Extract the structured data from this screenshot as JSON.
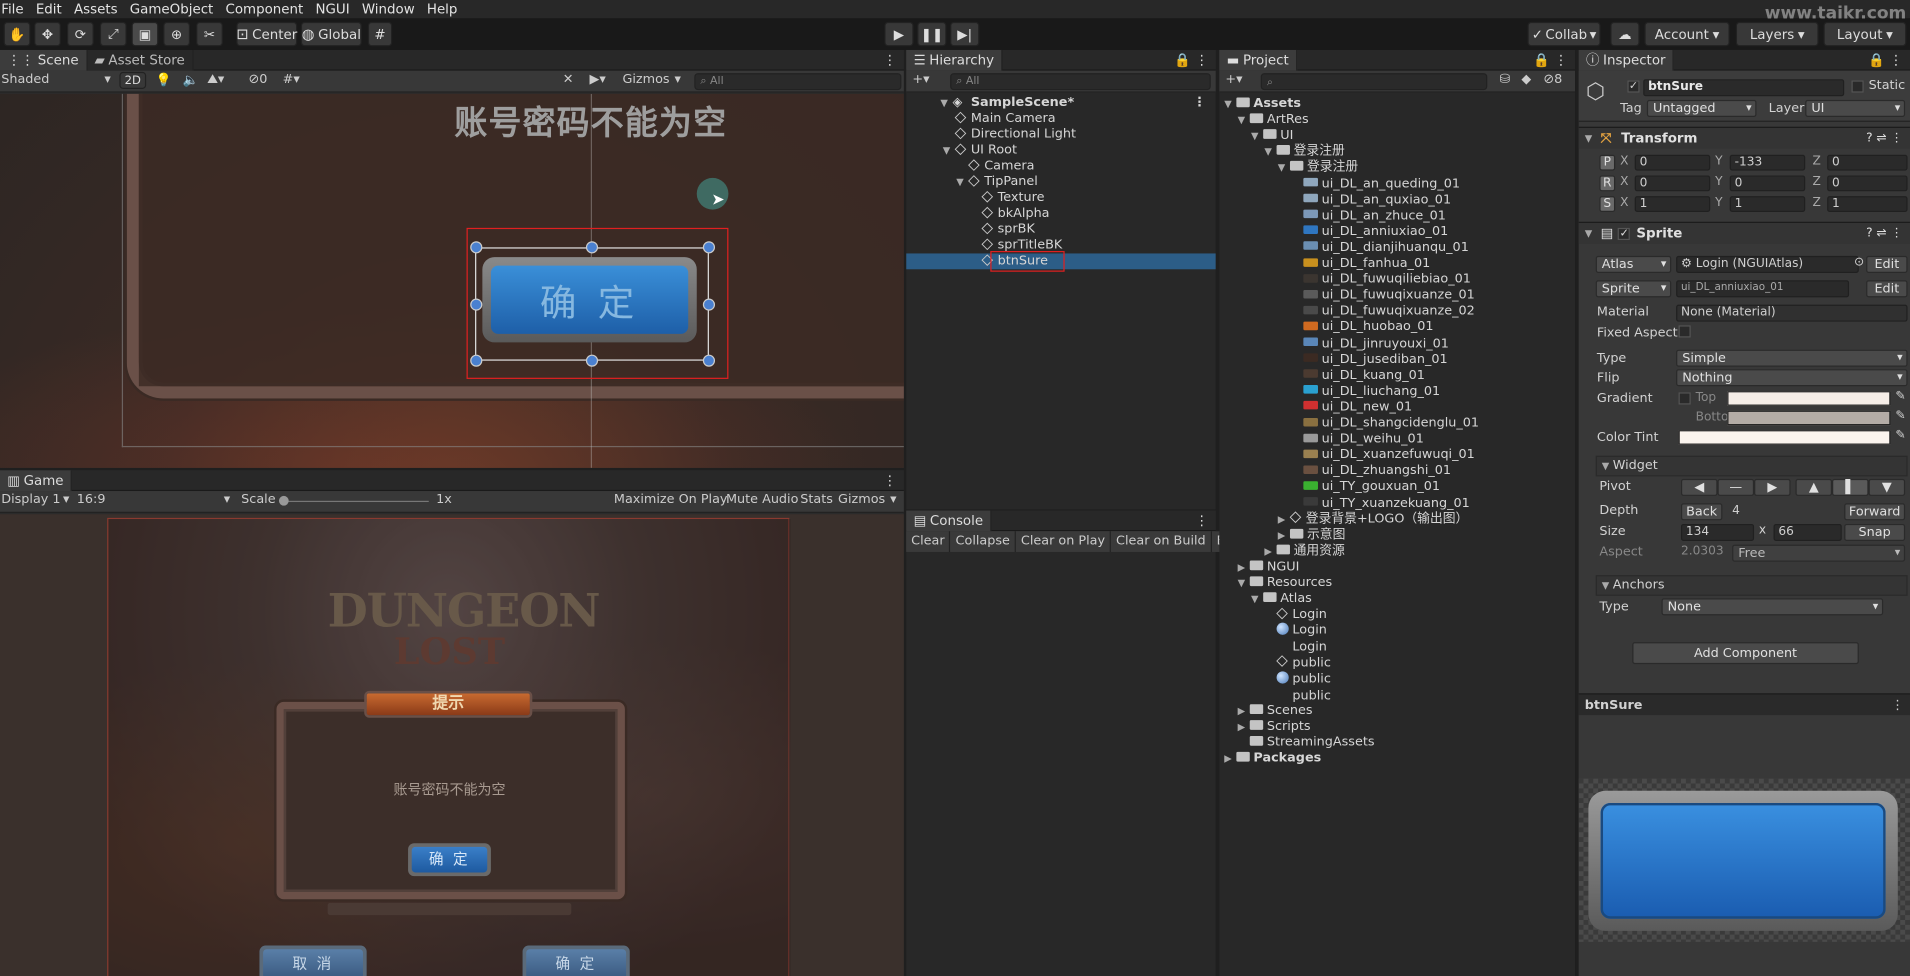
{
  "menu": [
    "File",
    "Edit",
    "Assets",
    "GameObject",
    "Component",
    "NGUI",
    "Window",
    "Help"
  ],
  "toolbar": {
    "center_label": "Center",
    "global_label": "Global",
    "collab_label": "Collab",
    "account_label": "Account",
    "layers_label": "Layers",
    "layout_label": "Layout",
    "watermark": "www.taikr.com"
  },
  "scene": {
    "tab_scene": "Scene",
    "tab_asset_store": "Asset Store",
    "shading_mode": "Shaded",
    "mode_2d": "2D",
    "hidden_count": "0",
    "gizmos_label": "Gizmos",
    "search_placeholder": "All",
    "overlay_text": "账号密码不能为空",
    "button_text": "确 定"
  },
  "game": {
    "tab_label": "Game",
    "display": "Display 1",
    "aspect": "16:9",
    "scale_label": "Scale",
    "scale_value": "1x",
    "maximize": "Maximize On Play",
    "mute": "Mute Audio",
    "stats": "Stats",
    "gizmos": "Gizmos",
    "logo_top": "DUNGEON",
    "logo_bottom": "LOST",
    "dialog_title": "提示",
    "dialog_message": "账号密码不能为空",
    "dialog_ok": "确 定",
    "cancel_button": "取 消",
    "confirm_button": "确 定"
  },
  "hierarchy": {
    "tab_label": "Hierarchy",
    "search_placeholder": "All",
    "scene_name": "SampleScene*",
    "items": [
      {
        "label": "Main Camera",
        "depth": 1
      },
      {
        "label": "Directional Light",
        "depth": 1
      },
      {
        "label": "UI Root",
        "depth": 1
      },
      {
        "label": "Camera",
        "depth": 2
      },
      {
        "label": "TipPanel",
        "depth": 2
      },
      {
        "label": "Texture",
        "depth": 3
      },
      {
        "label": "bkAlpha",
        "depth": 3
      },
      {
        "label": "sprBK",
        "depth": 3
      },
      {
        "label": "sprTitleBK",
        "depth": 3
      },
      {
        "label": "btnSure",
        "depth": 3
      }
    ]
  },
  "console": {
    "tab_label": "Console",
    "buttons": [
      "Clear",
      "Collapse",
      "Clear on Play",
      "Clear on Build",
      "Error P"
    ]
  },
  "project": {
    "tab_label": "Project",
    "hidden_count": "8",
    "items": [
      {
        "label": "Assets",
        "depth": 0,
        "kind": "folder",
        "bold": true
      },
      {
        "label": "ArtRes",
        "depth": 1,
        "kind": "folder"
      },
      {
        "label": "UI",
        "depth": 2,
        "kind": "folder"
      },
      {
        "label": "登录注册",
        "depth": 3,
        "kind": "folder"
      },
      {
        "label": "登录注册",
        "depth": 4,
        "kind": "folder"
      },
      {
        "label": "ui_DL_an_queding_01",
        "depth": 5,
        "kind": "sprite",
        "color": "#8fa7bd"
      },
      {
        "label": "ui_DL_an_quxiao_01",
        "depth": 5,
        "kind": "sprite",
        "color": "#8fa7bd"
      },
      {
        "label": "ui_DL_an_zhuce_01",
        "depth": 5,
        "kind": "sprite",
        "color": "#7c98b8"
      },
      {
        "label": "ui_DL_anniuxiao_01",
        "depth": 5,
        "kind": "sprite",
        "color": "#2f76c0"
      },
      {
        "label": "ui_DL_dianjihuanqu_01",
        "depth": 5,
        "kind": "sprite",
        "color": "#6b8fb3"
      },
      {
        "label": "ui_DL_fanhua_01",
        "depth": 5,
        "kind": "sprite",
        "color": "#c8901e"
      },
      {
        "label": "ui_DL_fuwuqiliebiao_01",
        "depth": 5,
        "kind": "sprite",
        "color": "#3b3530"
      },
      {
        "label": "ui_DL_fuwuqixuanze_01",
        "depth": 5,
        "kind": "sprite",
        "color": "#5a5a5a"
      },
      {
        "label": "ui_DL_fuwuqixuanze_02",
        "depth": 5,
        "kind": "sprite",
        "color": "#4a4a4a"
      },
      {
        "label": "ui_DL_huobao_01",
        "depth": 5,
        "kind": "sprite",
        "color": "#d06a20"
      },
      {
        "label": "ui_DL_jinruyouxi_01",
        "depth": 5,
        "kind": "sprite",
        "color": "#5a86b8"
      },
      {
        "label": "ui_DL_jusediban_01",
        "depth": 5,
        "kind": "sprite",
        "color": "#3b2a22"
      },
      {
        "label": "ui_DL_kuang_01",
        "depth": 5,
        "kind": "sprite",
        "color": "#4b3a30"
      },
      {
        "label": "ui_DL_liuchang_01",
        "depth": 5,
        "kind": "sprite",
        "color": "#2aa0d0"
      },
      {
        "label": "ui_DL_new_01",
        "depth": 5,
        "kind": "sprite",
        "color": "#d03030"
      },
      {
        "label": "ui_DL_shangcidenglu_01",
        "depth": 5,
        "kind": "sprite",
        "color": "#8a7040"
      },
      {
        "label": "ui_DL_weihu_01",
        "depth": 5,
        "kind": "sprite",
        "color": "#9a9a9a"
      },
      {
        "label": "ui_DL_xuanzefuwuqi_01",
        "depth": 5,
        "kind": "sprite",
        "color": "#9a8050"
      },
      {
        "label": "ui_DL_zhuangshi_01",
        "depth": 5,
        "kind": "sprite",
        "color": "#6a5040"
      },
      {
        "label": "ui_TY_gouxuan_01",
        "depth": 5,
        "kind": "sprite",
        "color": "#3ab030"
      },
      {
        "label": "ui_TY_xuanzekuang_01",
        "depth": 5,
        "kind": "sprite",
        "color": "#3a3a3a"
      },
      {
        "label": "登录背景+LOGO（输出图）",
        "depth": 4,
        "kind": "prefab"
      },
      {
        "label": "示意图",
        "depth": 4,
        "kind": "folder"
      },
      {
        "label": "通用资源",
        "depth": 3,
        "kind": "folder"
      },
      {
        "label": "NGUI",
        "depth": 1,
        "kind": "folder"
      },
      {
        "label": "Resources",
        "depth": 1,
        "kind": "folder"
      },
      {
        "label": "Atlas",
        "depth": 2,
        "kind": "folder"
      },
      {
        "label": "Login",
        "depth": 3,
        "kind": "prefab"
      },
      {
        "label": "Login",
        "depth": 3,
        "kind": "material"
      },
      {
        "label": "Login",
        "depth": 3,
        "kind": "texture"
      },
      {
        "label": "public",
        "depth": 3,
        "kind": "prefab"
      },
      {
        "label": "public",
        "depth": 3,
        "kind": "material"
      },
      {
        "label": "public",
        "depth": 3,
        "kind": "texture"
      },
      {
        "label": "Scenes",
        "depth": 1,
        "kind": "folder"
      },
      {
        "label": "Scripts",
        "depth": 1,
        "kind": "folder"
      },
      {
        "label": "StreamingAssets",
        "depth": 1,
        "kind": "folder"
      },
      {
        "label": "Packages",
        "depth": 0,
        "kind": "folder",
        "bold": true
      }
    ]
  },
  "inspector": {
    "tab_label": "Inspector",
    "object_name": "btnSure",
    "static_label": "Static",
    "tag_label": "Tag",
    "tag_value": "Untagged",
    "layer_label": "Layer",
    "layer_value": "UI",
    "transform": {
      "title": "Transform",
      "p": {
        "x": "0",
        "y": "-133",
        "z": "0"
      },
      "r": {
        "x": "0",
        "y": "0",
        "z": "0"
      },
      "s": {
        "x": "1",
        "y": "1",
        "z": "1"
      }
    },
    "sprite": {
      "title": "Sprite",
      "atlas_label": "Atlas",
      "atlas_value": "Login (NGUIAtlas)",
      "sprite_label": "Sprite",
      "sprite_value": "ui_DL_anniuxiao_01",
      "edit": "Edit",
      "material_label": "Material",
      "material_value": "None (Material)",
      "fixed_aspect_label": "Fixed Aspect",
      "type_label": "Type",
      "type_value": "Simple",
      "flip_label": "Flip",
      "flip_value": "Nothing",
      "gradient_label": "Gradient",
      "top_label": "Top",
      "bottom_label": "Bottom",
      "color_tint_label": "Color Tint"
    },
    "widget": {
      "title": "Widget",
      "pivot_label": "Pivot",
      "depth_label": "Depth",
      "back_label": "Back",
      "depth_value": "4",
      "forward_label": "Forward",
      "size_label": "Size",
      "size_w": "134",
      "size_x": "x",
      "size_h": "66",
      "snap_label": "Snap",
      "aspect_label": "Aspect",
      "aspect_value": "2.0303",
      "aspect_mode": "Free"
    },
    "anchors": {
      "title": "Anchors",
      "type_label": "Type",
      "type_value": "None"
    },
    "add_component": "Add Component",
    "preview_title": "btnSure"
  }
}
